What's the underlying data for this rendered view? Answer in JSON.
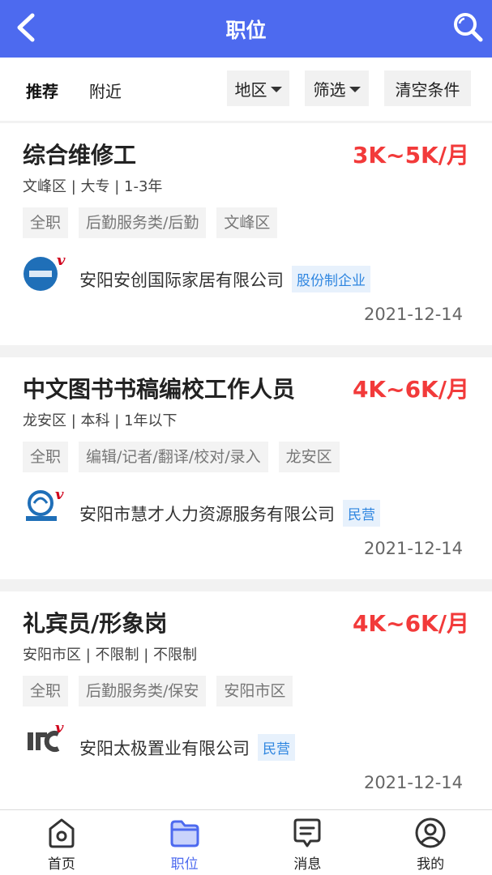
{
  "header": {
    "title": "职位",
    "back_icon": "back-arrow-icon",
    "search_icon": "search-icon"
  },
  "filters": {
    "tabs": [
      {
        "label": "推荐",
        "active": true
      },
      {
        "label": "附近",
        "active": false
      }
    ],
    "region_label": "地区",
    "filter_label": "筛选",
    "clear_label": "清空条件"
  },
  "jobs": [
    {
      "title": "综合维修工",
      "salary": "3K~5K/月",
      "meta": "文峰区 | 大专 | 1-3年",
      "tags": [
        "全职",
        "后勤服务类/后勤",
        "文峰区"
      ],
      "company": "安阳安创国际家居有限公司",
      "company_type": "股份制企业",
      "date": "2021-12-14"
    },
    {
      "title": "中文图书书稿编校工作人员",
      "salary": "4K~6K/月",
      "meta": "龙安区 | 本科 | 1年以下",
      "tags": [
        "全职",
        "编辑/记者/翻译/校对/录入",
        "龙安区"
      ],
      "company": "安阳市慧才人力资源服务有限公司",
      "company_type": "民营",
      "date": "2021-12-14"
    },
    {
      "title": "礼宾员/形象岗",
      "salary": "4K~6K/月",
      "meta": "安阳市区 | 不限制 | 不限制",
      "tags": [
        "全职",
        "后勤服务类/保安",
        "安阳市区"
      ],
      "company": "安阳太极置业有限公司",
      "company_type": "民营",
      "date": "2021-12-14"
    }
  ],
  "tabbar": [
    {
      "label": "首页",
      "icon": "home-icon",
      "active": false
    },
    {
      "label": "职位",
      "icon": "folder-icon",
      "active": true
    },
    {
      "label": "消息",
      "icon": "message-icon",
      "active": false
    },
    {
      "label": "我的",
      "icon": "user-icon",
      "active": false
    }
  ],
  "colors": {
    "primary": "#4d6aef",
    "salary": "#f23a3a",
    "badge_text": "#2f86e0",
    "verified_v": "#d0021b"
  }
}
